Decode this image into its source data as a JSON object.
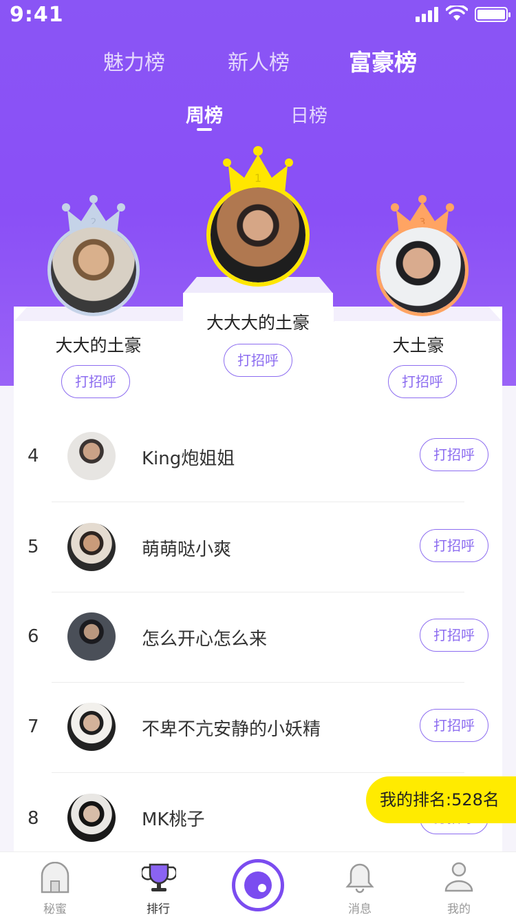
{
  "status_bar": {
    "time": "9:41"
  },
  "main_tabs": [
    {
      "label": "魅力榜",
      "active": false
    },
    {
      "label": "新人榜",
      "active": false
    },
    {
      "label": "富豪榜",
      "active": true
    }
  ],
  "sub_tabs": [
    {
      "label": "周榜",
      "active": true
    },
    {
      "label": "日榜",
      "active": false
    }
  ],
  "podium": [
    {
      "rank": "2",
      "name": "大大的土豪",
      "greet": "打招呼",
      "crown_color": "#c5d3e8",
      "ring_color": "#c5d3e8"
    },
    {
      "rank": "1",
      "name": "大大大的土豪",
      "greet": "打招呼",
      "crown_color": "#ffe600",
      "ring_color": "#ffe600"
    },
    {
      "rank": "3",
      "name": "大土豪",
      "greet": "打招呼",
      "crown_color": "#ffa463",
      "ring_color": "#ffa463"
    }
  ],
  "list": [
    {
      "rank": "4",
      "name": "King炮姐姐",
      "greet": "打招呼"
    },
    {
      "rank": "5",
      "name": "萌萌哒小爽",
      "greet": "打招呼"
    },
    {
      "rank": "6",
      "name": "怎么开心怎么来",
      "greet": "打招呼"
    },
    {
      "rank": "7",
      "name": "不卑不亢安静的小妖精",
      "greet": "打招呼"
    },
    {
      "rank": "8",
      "name": "MK桃子",
      "greet": "打招呼"
    }
  ],
  "my_rank": "我的排名:528名",
  "tabbar": [
    {
      "label": "秘蜜",
      "icon": "house-icon"
    },
    {
      "label": "排行",
      "icon": "trophy-icon"
    },
    {
      "label": "",
      "icon": "camera-icon"
    },
    {
      "label": "消息",
      "icon": "bell-icon"
    },
    {
      "label": "我的",
      "icon": "user-icon"
    }
  ],
  "colors": {
    "accent": "#8a55f5",
    "button": "#8c6cf0",
    "myrank_bg": "#ffeb00"
  }
}
